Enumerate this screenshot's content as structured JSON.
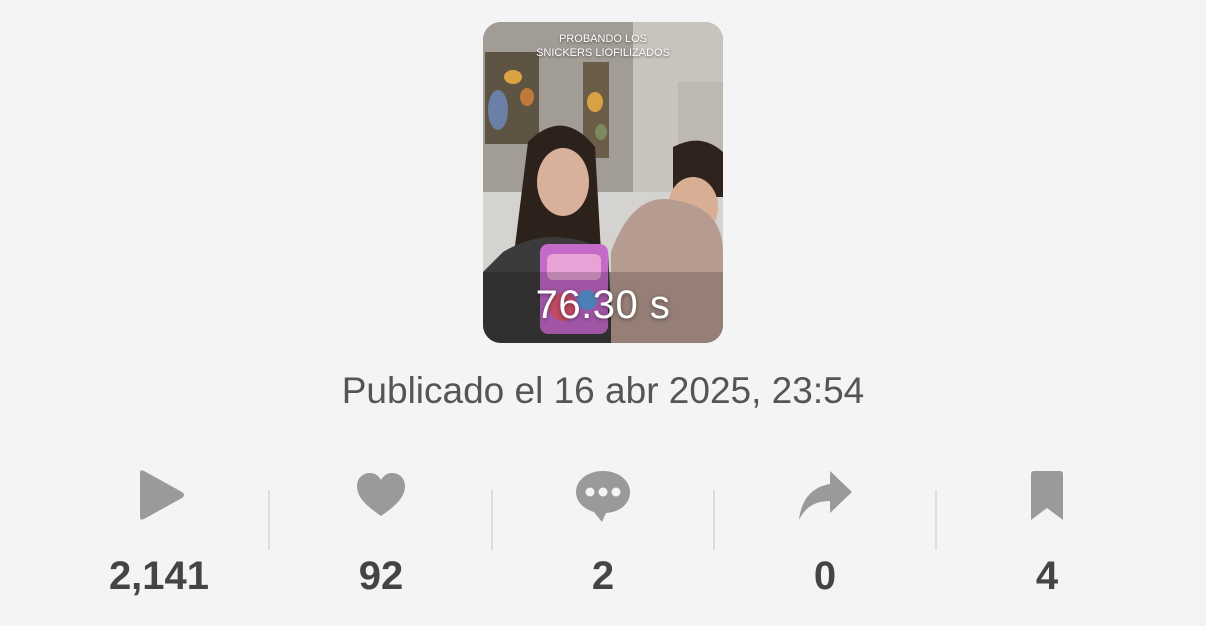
{
  "video": {
    "overlay_text": "PROBANDO LOS\nSNICKERS LIOFILIZADOS",
    "duration": "76.30 s"
  },
  "published": "Publicado el 16 abr 2025, 23:54",
  "stats": [
    {
      "icon": "play-icon",
      "value": "2,141"
    },
    {
      "icon": "heart-icon",
      "value": "92"
    },
    {
      "icon": "comment-icon",
      "value": "2"
    },
    {
      "icon": "share-icon",
      "value": "0"
    },
    {
      "icon": "bookmark-icon",
      "value": "4"
    }
  ],
  "colors": {
    "background": "#f4f4f4",
    "icon": "#9a9a9a",
    "number": "#444444",
    "text": "#555555"
  }
}
